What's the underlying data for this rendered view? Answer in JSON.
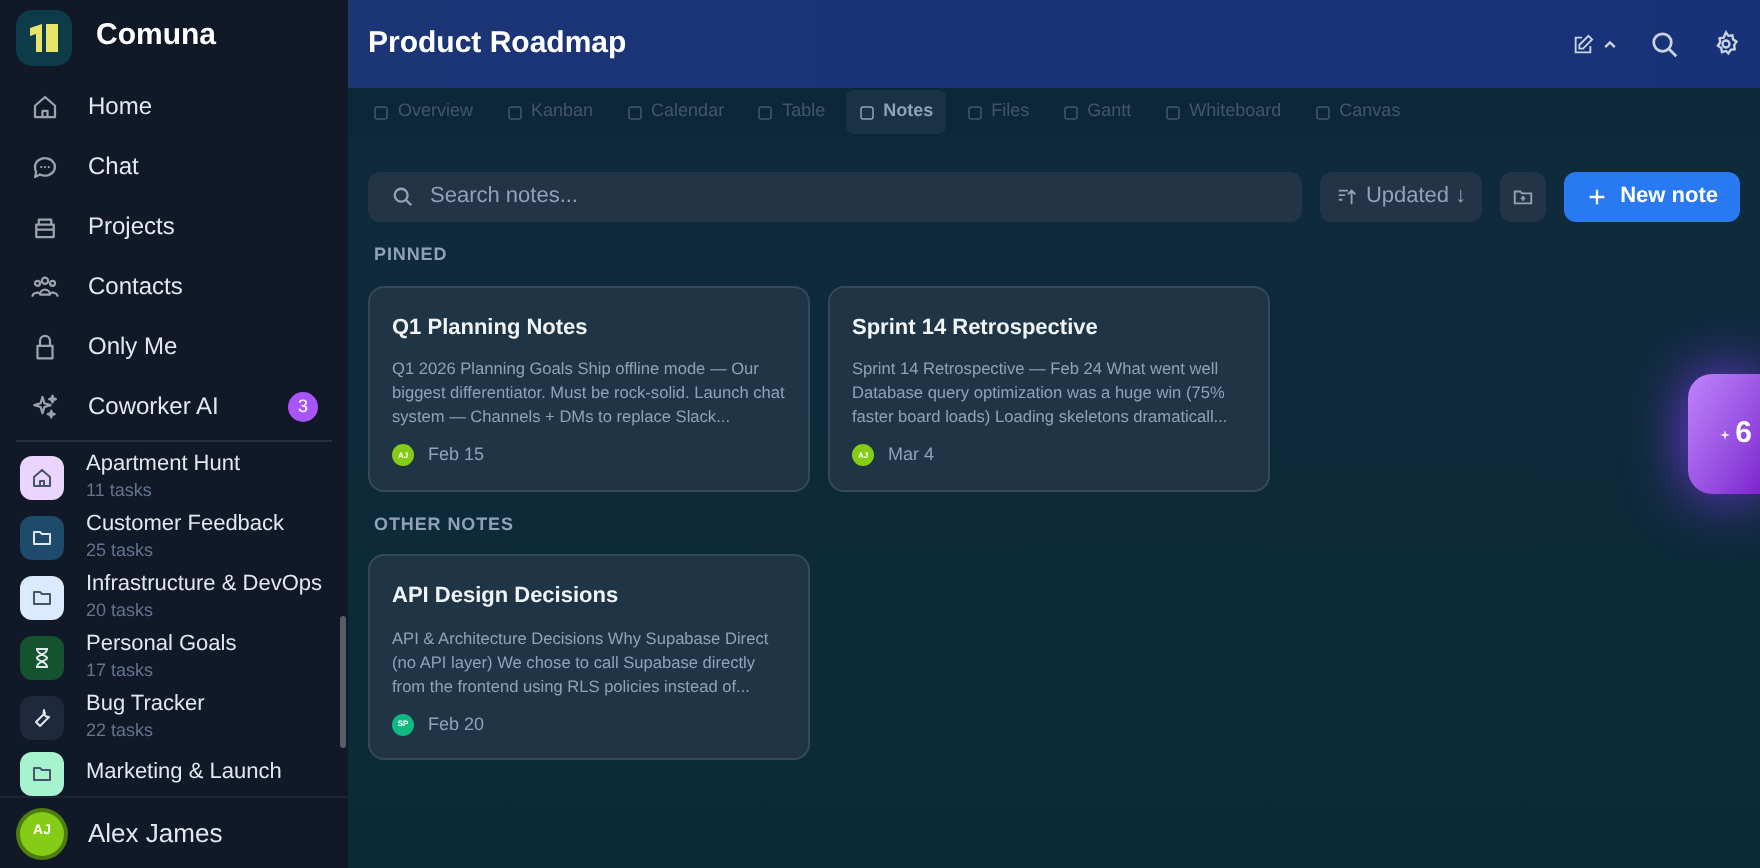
{
  "app": {
    "name": "Comuna"
  },
  "nav": [
    {
      "label": "Home"
    },
    {
      "label": "Chat"
    },
    {
      "label": "Projects"
    },
    {
      "label": "Contacts"
    },
    {
      "label": "Only Me"
    },
    {
      "label": "Coworker AI",
      "badge": "3"
    }
  ],
  "projects": [
    {
      "name": "Apartment Hunt",
      "tasks": "11 tasks",
      "color": "#e9d5ff"
    },
    {
      "name": "Customer Feedback",
      "tasks": "25 tasks",
      "color": "#1e4a6b"
    },
    {
      "name": "Infrastructure & DevOps",
      "tasks": "20 tasks",
      "color": "#dbeafe"
    },
    {
      "name": "Personal Goals",
      "tasks": "17 tasks",
      "color": "#14532d"
    },
    {
      "name": "Bug Tracker",
      "tasks": "22 tasks",
      "color": "#1e293b"
    },
    {
      "name": "Marketing & Launch",
      "color": "#a7f3d0"
    }
  ],
  "user": {
    "initials": "AJ",
    "name": "Alex James"
  },
  "header": {
    "title": "Product Roadmap"
  },
  "tabs": [
    {
      "label": "Overview",
      "selected": false
    },
    {
      "label": "Kanban",
      "selected": false
    },
    {
      "label": "Calendar",
      "selected": false
    },
    {
      "label": "Table",
      "selected": false
    },
    {
      "label": "Notes",
      "selected": true
    },
    {
      "label": "Files",
      "selected": false
    },
    {
      "label": "Gantt",
      "selected": false
    },
    {
      "label": "Whiteboard",
      "selected": false
    },
    {
      "label": "Canvas",
      "selected": false
    }
  ],
  "toolbar": {
    "search_placeholder": "Search notes...",
    "sort": "Updated ↓",
    "new_button": "New note"
  },
  "sections": [
    {
      "heading": "PINNED",
      "notes": [
        {
          "title": "Q1 Planning Notes",
          "excerpt": "Q1 2026 Planning Goals Ship offline mode — Our biggest differentiator. Must be rock-solid. Launch chat system — Channels + DMs to replace Slack...",
          "initials": "AJ",
          "color": "#84cc16",
          "date": "Feb 15"
        },
        {
          "title": "Sprint 14 Retrospective",
          "excerpt": "Sprint 14 Retrospective — Feb 24 What went well Database query optimization was a huge win (75% faster board loads) Loading skeletons dramaticall...",
          "initials": "AJ",
          "color": "#84cc16",
          "date": "Mar 4"
        }
      ]
    },
    {
      "heading": "OTHER NOTES",
      "notes": [
        {
          "title": "API Design Decisions",
          "excerpt": "API & Architecture Decisions Why Supabase Direct (no API layer) We chose to call Supabase directly from the frontend using RLS policies instead of...",
          "initials": "SP",
          "color": "#10b981",
          "date": "Feb 20"
        }
      ]
    }
  ],
  "floating_widget": {
    "count": "6"
  }
}
